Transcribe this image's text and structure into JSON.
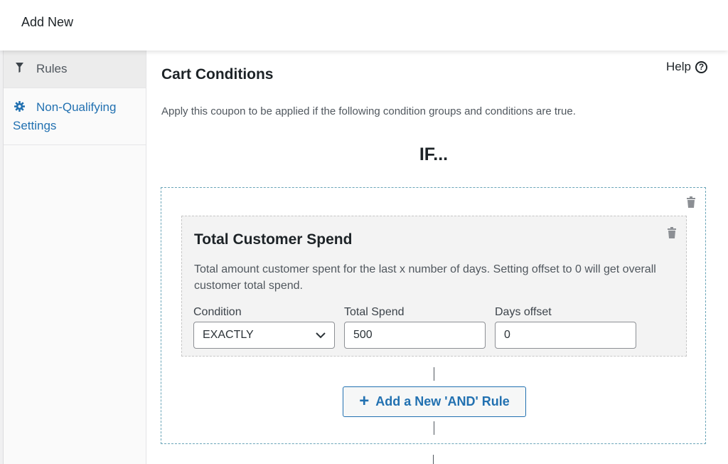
{
  "header": {
    "title": "Add New"
  },
  "sidebar": {
    "items": [
      {
        "label": "Rules",
        "icon": "funnel-icon",
        "active": true
      },
      {
        "label_line1": "Non-Qualifying",
        "label_line2": "Settings",
        "icon": "gear-icon",
        "active": false
      }
    ]
  },
  "main": {
    "title": "Cart Conditions",
    "help_label": "Help",
    "help_icon": "?",
    "description": "Apply this coupon to be applied if the following condition groups and conditions are true.",
    "if_label": "IF..."
  },
  "condition": {
    "title": "Total Customer Spend",
    "description": "Total amount customer spent for the last x number of days. Setting offset to 0 will get overall customer total spend.",
    "fields": {
      "condition_label": "Condition",
      "condition_value": "EXACTLY",
      "total_spend_label": "Total Spend",
      "total_spend_value": "500",
      "days_offset_label": "Days offset",
      "days_offset_value": "0"
    }
  },
  "add_rule_button": {
    "label": "Add a New 'AND' Rule",
    "icon": "+"
  },
  "colors": {
    "accent": "#2271b1",
    "group_border": "#6aa5b8",
    "card_bg": "#f3f3f3",
    "sidebar_active_bg": "#ececec"
  }
}
